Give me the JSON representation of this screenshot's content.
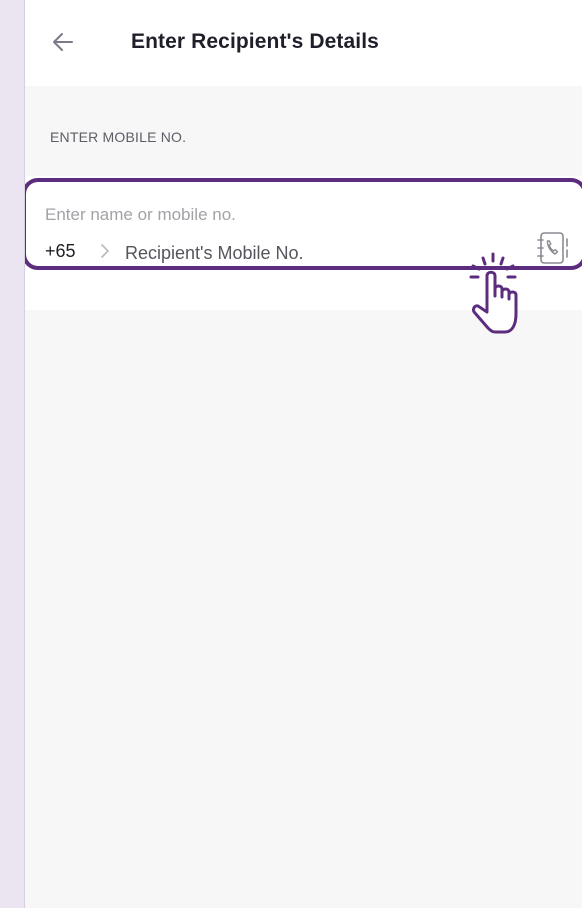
{
  "header": {
    "title": "Enter Recipient's Details",
    "back_icon": "arrow-left-icon"
  },
  "section": {
    "label": "ENTER MOBILE NO."
  },
  "recipient_field": {
    "hint": "Enter name or mobile no.",
    "country_code": "+65",
    "mobile_placeholder": "Recipient's Mobile No.",
    "mobile_value": "",
    "contacts_icon": "contact-book-icon"
  },
  "overlay": {
    "pointer_icon": "tap-hand-icon"
  },
  "colors": {
    "highlight": "#5c2d7e",
    "background": "#f7f7f7",
    "frame": "#ebe4f1"
  }
}
